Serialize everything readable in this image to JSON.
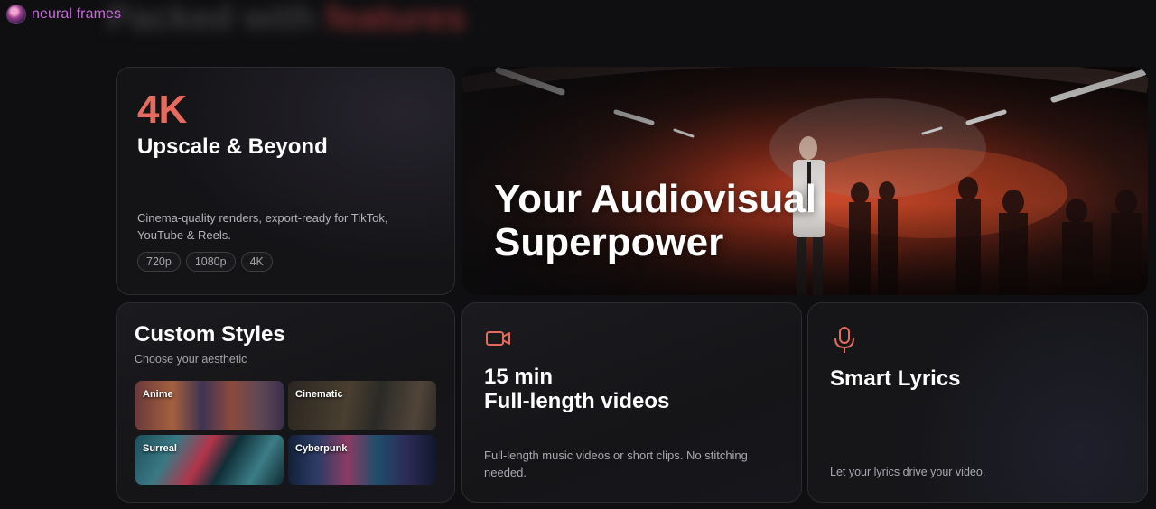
{
  "brand": {
    "name": "neural frames"
  },
  "header": {
    "blurred_title_a": "Packed with ",
    "blurred_title_b": "features"
  },
  "card_4k": {
    "big_label": "4K",
    "title": "Upscale & Beyond",
    "description": "Cinema-quality renders, export-ready for TikTok, YouTube & Reels.",
    "chips": [
      "720p",
      "1080p",
      "4K"
    ]
  },
  "hero": {
    "line1": "Your Audiovisual",
    "line2": "Superpower"
  },
  "styles_card": {
    "title": "Custom Styles",
    "subtitle": "Choose your aesthetic",
    "tiles": [
      "Anime",
      "Cinematic",
      "Surreal",
      "Cyberpunk"
    ]
  },
  "length_card": {
    "title_line1": "15 min",
    "title_line2": "Full-length videos",
    "description": "Full-length music videos or short clips. No stitching needed."
  },
  "lyrics_card": {
    "title": "Smart Lyrics",
    "description": "Let your lyrics drive your video."
  },
  "colors": {
    "accent": "#e66a5e",
    "brand": "#c76bd8",
    "background": "#0f0f11"
  },
  "icons": {
    "video": "video-camera-icon",
    "mic": "microphone-icon"
  }
}
